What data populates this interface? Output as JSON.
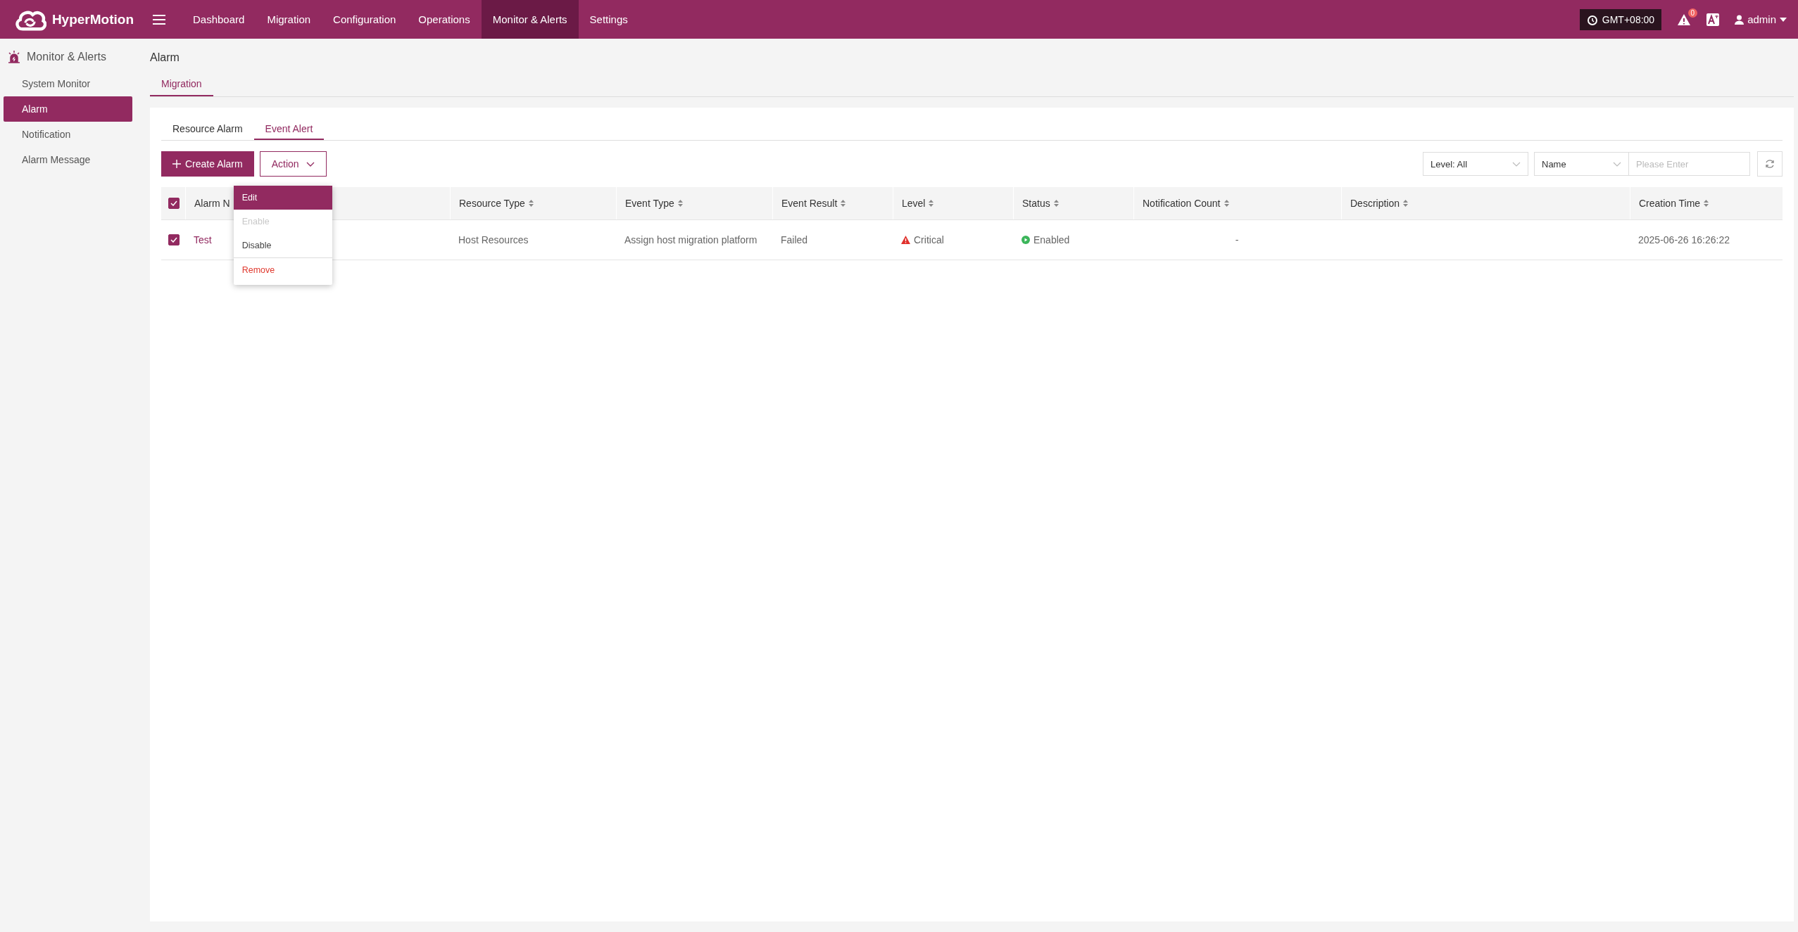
{
  "top_bar": {
    "logo_text": "HyperMotion",
    "nav": [
      {
        "label": "Dashboard",
        "selected": false
      },
      {
        "label": "Migration",
        "selected": false
      },
      {
        "label": "Configuration",
        "selected": false
      },
      {
        "label": "Operations",
        "selected": false
      },
      {
        "label": "Monitor & Alerts",
        "selected": true
      },
      {
        "label": "Settings",
        "selected": false
      }
    ],
    "timezone": "GMT+08:00",
    "alert_count": "0",
    "user": "admin"
  },
  "sidebar": {
    "title": "Monitor & Alerts",
    "items": [
      {
        "label": "System Monitor",
        "selected": false
      },
      {
        "label": "Alarm",
        "selected": true
      },
      {
        "label": "Notification",
        "selected": false
      },
      {
        "label": "Alarm Message",
        "selected": false
      }
    ]
  },
  "page_title": "Alarm",
  "page_tabs": [
    {
      "label": "Migration",
      "selected": true
    }
  ],
  "sub_tabs": [
    {
      "label": "Resource Alarm",
      "selected": false
    },
    {
      "label": "Event Alert",
      "selected": true
    }
  ],
  "create_button": "Create Alarm",
  "action_button": "Action",
  "filters": {
    "level": "Level: All",
    "field": "Name",
    "search_placeholder": "Please Enter"
  },
  "action_menu": [
    {
      "label": "Edit",
      "selected": true,
      "disabled": false,
      "kind": "normal"
    },
    {
      "label": "Enable",
      "selected": false,
      "disabled": true,
      "kind": "normal"
    },
    {
      "label": "Disable",
      "selected": false,
      "disabled": false,
      "kind": "normal"
    },
    {
      "label": "Remove",
      "selected": false,
      "disabled": false,
      "kind": "danger"
    }
  ],
  "table": {
    "header_checked": true,
    "columns": [
      {
        "label": "Alarm N",
        "sortable": false
      },
      {
        "label": "Resource Type",
        "sortable": true
      },
      {
        "label": "Event Type",
        "sortable": true
      },
      {
        "label": "Event Result",
        "sortable": true
      },
      {
        "label": "Level",
        "sortable": true
      },
      {
        "label": "Status",
        "sortable": true
      },
      {
        "label": "Notification Count",
        "sortable": true
      },
      {
        "label": "Description",
        "sortable": true
      },
      {
        "label": "Creation Time",
        "sortable": true
      }
    ],
    "rows": [
      {
        "checked": true,
        "name": "Test",
        "resource_type": "Host Resources",
        "event_type": "Assign host migration platform",
        "event_result": "Failed",
        "level": {
          "label": "Critical"
        },
        "status": {
          "label": "Enabled",
          "enabled": true
        },
        "notification_count": "-",
        "creation_time": "2025-06-26 16:26:22"
      }
    ]
  }
}
